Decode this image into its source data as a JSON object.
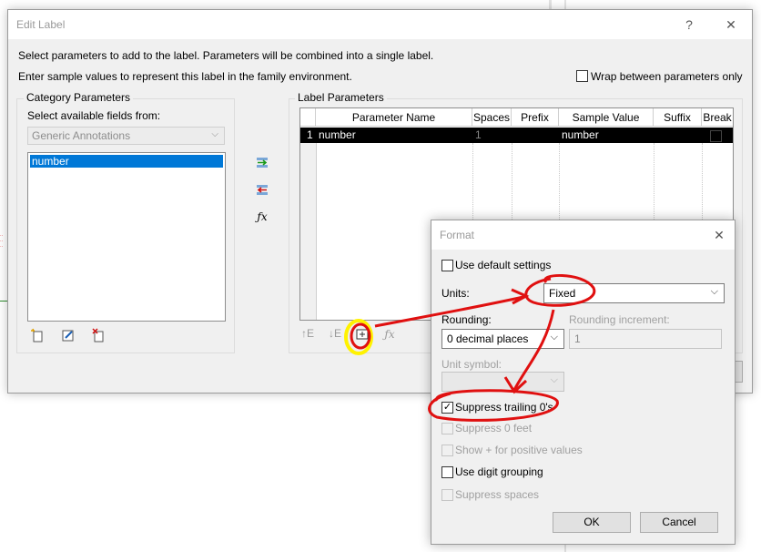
{
  "edit_label": {
    "title": "Edit Label",
    "help": "?",
    "close": "✕",
    "intro1": "Select parameters to add to the label.  Parameters will be combined into a single label.",
    "intro2": "Enter sample values to represent this label in the family environment.",
    "wrap_label": "Wrap between parameters only",
    "category_group": "Category Parameters",
    "select_fields_label": "Select available fields from:",
    "category_combo": "Generic Annotations",
    "available_fields": [
      "number"
    ],
    "label_group": "Label Parameters",
    "table": {
      "headers": [
        "Parameter Name",
        "Spaces",
        "Prefix",
        "Sample Value",
        "Suffix",
        "Break"
      ],
      "rows": [
        {
          "index": "1",
          "name": "number",
          "spaces": "1",
          "prefix": "",
          "sample": "number",
          "suffix": ""
        }
      ]
    }
  },
  "format": {
    "title": "Format",
    "close": "✕",
    "use_default": "Use default settings",
    "units_label": "Units:",
    "units_value": "Fixed",
    "rounding_label": "Rounding:",
    "rounding_value": "0 decimal places",
    "rounding_increment_label": "Rounding increment:",
    "rounding_increment_value": "1",
    "unit_symbol_label": "Unit symbol:",
    "suppress_trailing": "Suppress trailing 0's",
    "suppress_feet": "Suppress 0 feet",
    "show_plus": "Show + for positive values",
    "digit_grouping": "Use digit grouping",
    "suppress_spaces": "Suppress spaces",
    "ok": "OK",
    "cancel": "Cancel",
    "checked": {
      "use_default": false,
      "suppress_trailing": true,
      "suppress_feet": false,
      "show_plus": false,
      "digit_grouping": false,
      "suppress_spaces": false
    }
  },
  "colors": {
    "annotation": "#e01010",
    "highlight": "#fff200",
    "selection": "#0078d7"
  },
  "icons": [
    "add-parameter-icon",
    "remove-parameter-icon",
    "fx-icon",
    "new-parameter-icon",
    "edit-parameter-icon",
    "delete-parameter-icon",
    "move-up-icon",
    "move-down-icon",
    "format-icon",
    "formula-icon"
  ]
}
